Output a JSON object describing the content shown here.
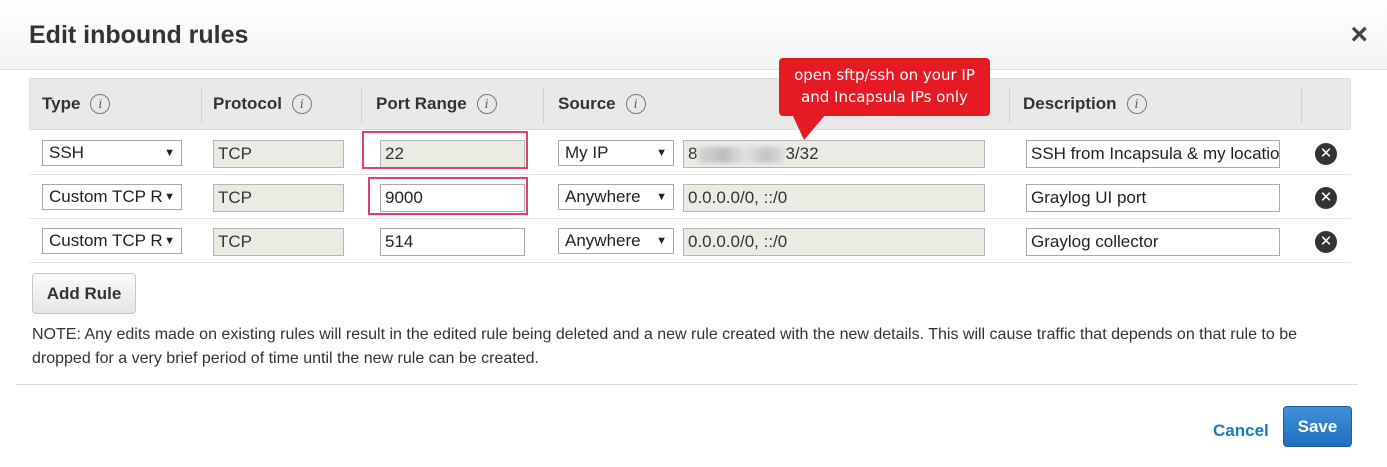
{
  "dialog": {
    "title": "Edit inbound rules",
    "close_icon": "×"
  },
  "columns": {
    "type": "Type",
    "protocol": "Protocol",
    "port_range": "Port Range",
    "source": "Source",
    "description": "Description",
    "info_glyph": "i"
  },
  "rules": [
    {
      "type": "SSH",
      "protocol": "TCP",
      "port": "22",
      "source_type": "My IP",
      "source_prefix": "8",
      "source_suffix": "3/32",
      "description": "SSH from Incapsula & my location"
    },
    {
      "type": "Custom TCP R",
      "protocol": "TCP",
      "port": "9000",
      "source_type": "Anywhere",
      "source_value": "0.0.0.0/0, ::/0",
      "description": "Graylog UI port"
    },
    {
      "type": "Custom TCP R",
      "protocol": "TCP",
      "port": "514",
      "source_type": "Anywhere",
      "source_value": "0.0.0.0/0, ::/0",
      "description": "Graylog collector"
    }
  ],
  "icons": {
    "caret": "▼",
    "delete": "✕"
  },
  "add_rule_label": "Add Rule",
  "note": "NOTE: Any edits made on existing rules will result in the edited rule being deleted and a new rule created with the new details. This will cause traffic that depends on that rule to be dropped for a very brief period of time until the new rule can be created.",
  "callout": {
    "line1": "open sftp/ssh on your IP",
    "line2": "and Incapsula IPs only",
    "color": "#e61a23"
  },
  "footer": {
    "cancel_label": "Cancel",
    "save_label": "Save"
  },
  "colors": {
    "accent": "#1a78c2",
    "highlight": "#e0406a"
  }
}
